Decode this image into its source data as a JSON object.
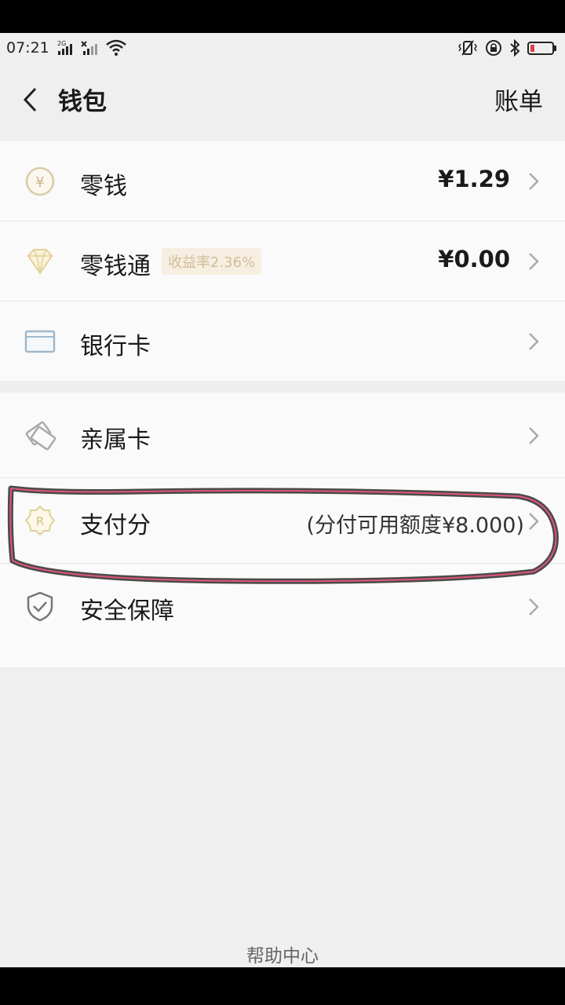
{
  "status_bar": {
    "time": "07:21",
    "network_label": "2G",
    "icons": [
      "signal-icon",
      "signal-no-sim-icon",
      "wifi-icon",
      "vibrate-icon",
      "lock-rotation-icon",
      "bluetooth-icon",
      "battery-icon"
    ]
  },
  "nav": {
    "back_icon": "chevron-left-icon",
    "title": "钱包",
    "action_label": "账单"
  },
  "wallet_items": [
    {
      "label": "零钱",
      "value": "¥1.29",
      "icon": "yuan-coin-icon"
    },
    {
      "label": "零钱通",
      "badge": "收益率2.36%",
      "value": "¥0.00",
      "icon": "diamond-icon"
    },
    {
      "label": "银行卡",
      "icon": "bank-card-icon"
    }
  ],
  "service_items": [
    {
      "label": "亲属卡",
      "icon": "family-card-icon"
    },
    {
      "label": "支付分",
      "value": "(分付可用额度¥8.000)",
      "icon": "score-badge-icon"
    },
    {
      "label": "安全保障",
      "icon": "shield-icon"
    }
  ],
  "footer": {
    "help_label": "帮助中心"
  },
  "colors": {
    "background": "#efefef",
    "card": "#fafafa",
    "badge_text": "#d2bc97",
    "annotation_loop": "#e0557a"
  }
}
